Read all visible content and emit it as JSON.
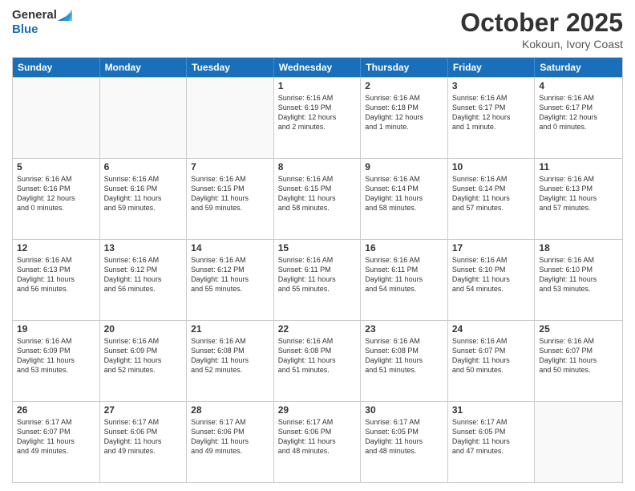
{
  "logo": {
    "line1": "General",
    "line2": "Blue"
  },
  "title": "October 2025",
  "location": "Kokoun, Ivory Coast",
  "days_of_week": [
    "Sunday",
    "Monday",
    "Tuesday",
    "Wednesday",
    "Thursday",
    "Friday",
    "Saturday"
  ],
  "weeks": [
    [
      {
        "day": "",
        "info": ""
      },
      {
        "day": "",
        "info": ""
      },
      {
        "day": "",
        "info": ""
      },
      {
        "day": "1",
        "info": "Sunrise: 6:16 AM\nSunset: 6:19 PM\nDaylight: 12 hours\nand 2 minutes."
      },
      {
        "day": "2",
        "info": "Sunrise: 6:16 AM\nSunset: 6:18 PM\nDaylight: 12 hours\nand 1 minute."
      },
      {
        "day": "3",
        "info": "Sunrise: 6:16 AM\nSunset: 6:17 PM\nDaylight: 12 hours\nand 1 minute."
      },
      {
        "day": "4",
        "info": "Sunrise: 6:16 AM\nSunset: 6:17 PM\nDaylight: 12 hours\nand 0 minutes."
      }
    ],
    [
      {
        "day": "5",
        "info": "Sunrise: 6:16 AM\nSunset: 6:16 PM\nDaylight: 12 hours\nand 0 minutes."
      },
      {
        "day": "6",
        "info": "Sunrise: 6:16 AM\nSunset: 6:16 PM\nDaylight: 11 hours\nand 59 minutes."
      },
      {
        "day": "7",
        "info": "Sunrise: 6:16 AM\nSunset: 6:15 PM\nDaylight: 11 hours\nand 59 minutes."
      },
      {
        "day": "8",
        "info": "Sunrise: 6:16 AM\nSunset: 6:15 PM\nDaylight: 11 hours\nand 58 minutes."
      },
      {
        "day": "9",
        "info": "Sunrise: 6:16 AM\nSunset: 6:14 PM\nDaylight: 11 hours\nand 58 minutes."
      },
      {
        "day": "10",
        "info": "Sunrise: 6:16 AM\nSunset: 6:14 PM\nDaylight: 11 hours\nand 57 minutes."
      },
      {
        "day": "11",
        "info": "Sunrise: 6:16 AM\nSunset: 6:13 PM\nDaylight: 11 hours\nand 57 minutes."
      }
    ],
    [
      {
        "day": "12",
        "info": "Sunrise: 6:16 AM\nSunset: 6:13 PM\nDaylight: 11 hours\nand 56 minutes."
      },
      {
        "day": "13",
        "info": "Sunrise: 6:16 AM\nSunset: 6:12 PM\nDaylight: 11 hours\nand 56 minutes."
      },
      {
        "day": "14",
        "info": "Sunrise: 6:16 AM\nSunset: 6:12 PM\nDaylight: 11 hours\nand 55 minutes."
      },
      {
        "day": "15",
        "info": "Sunrise: 6:16 AM\nSunset: 6:11 PM\nDaylight: 11 hours\nand 55 minutes."
      },
      {
        "day": "16",
        "info": "Sunrise: 6:16 AM\nSunset: 6:11 PM\nDaylight: 11 hours\nand 54 minutes."
      },
      {
        "day": "17",
        "info": "Sunrise: 6:16 AM\nSunset: 6:10 PM\nDaylight: 11 hours\nand 54 minutes."
      },
      {
        "day": "18",
        "info": "Sunrise: 6:16 AM\nSunset: 6:10 PM\nDaylight: 11 hours\nand 53 minutes."
      }
    ],
    [
      {
        "day": "19",
        "info": "Sunrise: 6:16 AM\nSunset: 6:09 PM\nDaylight: 11 hours\nand 53 minutes."
      },
      {
        "day": "20",
        "info": "Sunrise: 6:16 AM\nSunset: 6:09 PM\nDaylight: 11 hours\nand 52 minutes."
      },
      {
        "day": "21",
        "info": "Sunrise: 6:16 AM\nSunset: 6:08 PM\nDaylight: 11 hours\nand 52 minutes."
      },
      {
        "day": "22",
        "info": "Sunrise: 6:16 AM\nSunset: 6:08 PM\nDaylight: 11 hours\nand 51 minutes."
      },
      {
        "day": "23",
        "info": "Sunrise: 6:16 AM\nSunset: 6:08 PM\nDaylight: 11 hours\nand 51 minutes."
      },
      {
        "day": "24",
        "info": "Sunrise: 6:16 AM\nSunset: 6:07 PM\nDaylight: 11 hours\nand 50 minutes."
      },
      {
        "day": "25",
        "info": "Sunrise: 6:16 AM\nSunset: 6:07 PM\nDaylight: 11 hours\nand 50 minutes."
      }
    ],
    [
      {
        "day": "26",
        "info": "Sunrise: 6:17 AM\nSunset: 6:07 PM\nDaylight: 11 hours\nand 49 minutes."
      },
      {
        "day": "27",
        "info": "Sunrise: 6:17 AM\nSunset: 6:06 PM\nDaylight: 11 hours\nand 49 minutes."
      },
      {
        "day": "28",
        "info": "Sunrise: 6:17 AM\nSunset: 6:06 PM\nDaylight: 11 hours\nand 49 minutes."
      },
      {
        "day": "29",
        "info": "Sunrise: 6:17 AM\nSunset: 6:06 PM\nDaylight: 11 hours\nand 48 minutes."
      },
      {
        "day": "30",
        "info": "Sunrise: 6:17 AM\nSunset: 6:05 PM\nDaylight: 11 hours\nand 48 minutes."
      },
      {
        "day": "31",
        "info": "Sunrise: 6:17 AM\nSunset: 6:05 PM\nDaylight: 11 hours\nand 47 minutes."
      },
      {
        "day": "",
        "info": ""
      }
    ]
  ]
}
